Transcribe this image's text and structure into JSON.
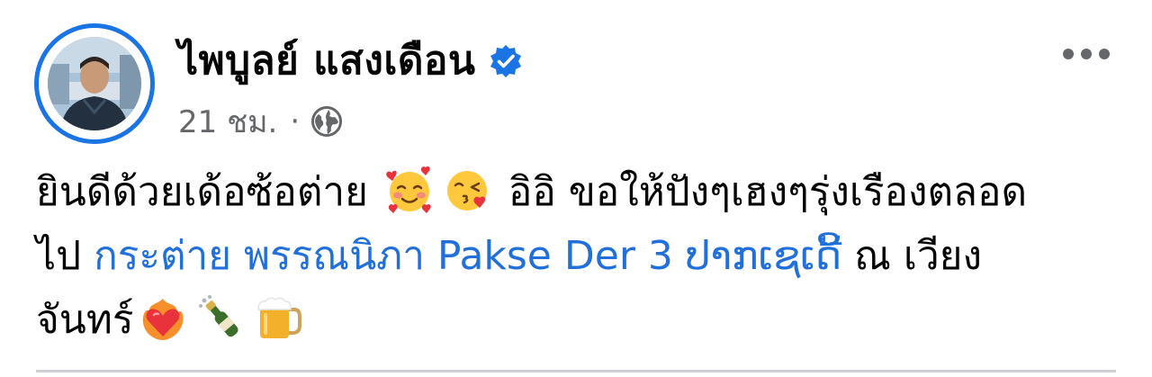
{
  "post": {
    "author": {
      "name": "ไพบูลย์ แสงเดือน",
      "verified_icon": "verified-badge-icon",
      "avatar_icon": "profile-avatar"
    },
    "meta": {
      "time": "21 ชม.",
      "separator": "·",
      "audience_icon": "globe-icon"
    },
    "more_icon": "more-options-icon",
    "message": {
      "line1_text": "ยินดีด้วยเด้อซ้อต่าย",
      "line1_text2": "อิอิ ขอให้ปังๆเฮงๆรุ่งเรืองตลอด",
      "line2_text": "ไป",
      "line2_link": "กระต่าย พรรณนิภา Pakse Der 3 ປາກເຊເດີ້",
      "line2_text2": "ณ เวียง",
      "line3_text": "จันทร์"
    },
    "emojis": [
      "smiling-face-with-hearts",
      "face-blowing-kiss",
      "heart-on-fire",
      "champagne-bottle",
      "beer-mug"
    ]
  },
  "colors": {
    "accent": "#1b74e4",
    "link": "#216fdb",
    "secondary_text": "#65676b",
    "text": "#050505"
  }
}
